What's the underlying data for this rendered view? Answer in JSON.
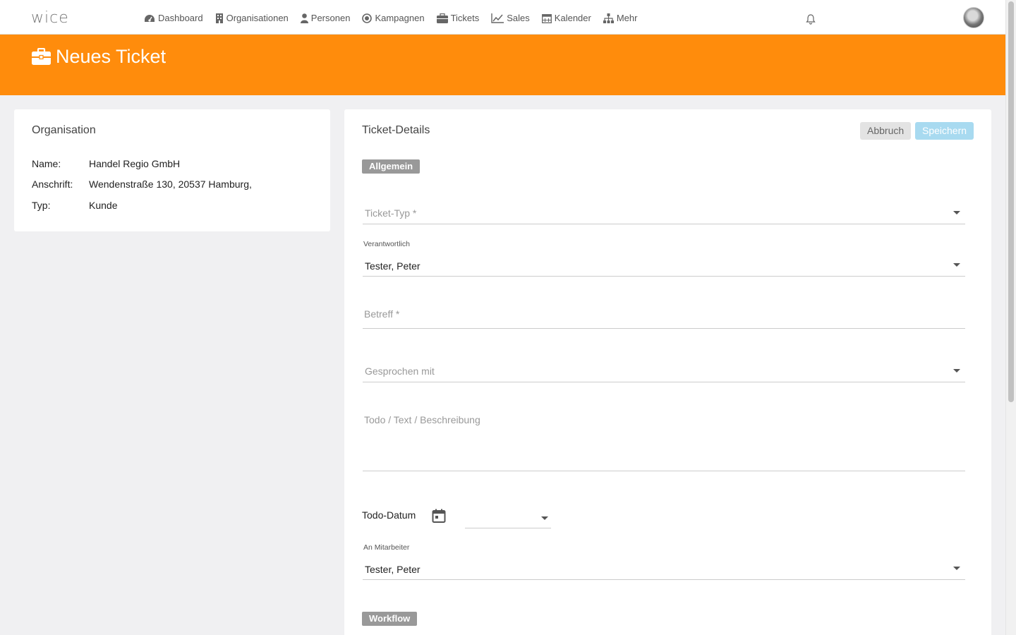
{
  "app": {
    "logo": "wice"
  },
  "nav": {
    "items": [
      {
        "label": "Dashboard",
        "icon": "dashboard-icon"
      },
      {
        "label": "Organisationen",
        "icon": "building-icon"
      },
      {
        "label": "Personen",
        "icon": "person-icon"
      },
      {
        "label": "Kampagnen",
        "icon": "target-icon"
      },
      {
        "label": "Tickets",
        "icon": "briefcase-icon"
      },
      {
        "label": "Sales",
        "icon": "chart-line-icon"
      },
      {
        "label": "Kalender",
        "icon": "calendar-icon"
      },
      {
        "label": "Mehr",
        "icon": "sitemap-icon"
      }
    ]
  },
  "header": {
    "title": "Neues Ticket",
    "background_color": "#ff8c0c"
  },
  "organisation_card": {
    "title": "Organisation",
    "rows": [
      {
        "label": "Name:",
        "value": "Handel Regio GmbH"
      },
      {
        "label": "Anschrift:",
        "value": "Wendenstraße 130, 20537 Hamburg,"
      },
      {
        "label": "Typ:",
        "value": "Kunde"
      }
    ]
  },
  "ticket_card": {
    "title": "Ticket-Details",
    "cancel_label": "Abbruch",
    "save_label": "Speichern",
    "section_general": "Allgemein",
    "section_workflow": "Workflow",
    "ticket_type_placeholder": "Ticket-Typ *",
    "responsible_label": "Verantwortlich",
    "responsible_value": "Tester, Peter",
    "subject_placeholder": "Betreff *",
    "spoken_with_placeholder": "Gesprochen mit",
    "description_placeholder": "Todo / Text / Beschreibung",
    "todo_date_label": "Todo-Datum",
    "todo_date_value": "",
    "employee_label": "An Mitarbeiter",
    "employee_value": "Tester, Peter"
  }
}
